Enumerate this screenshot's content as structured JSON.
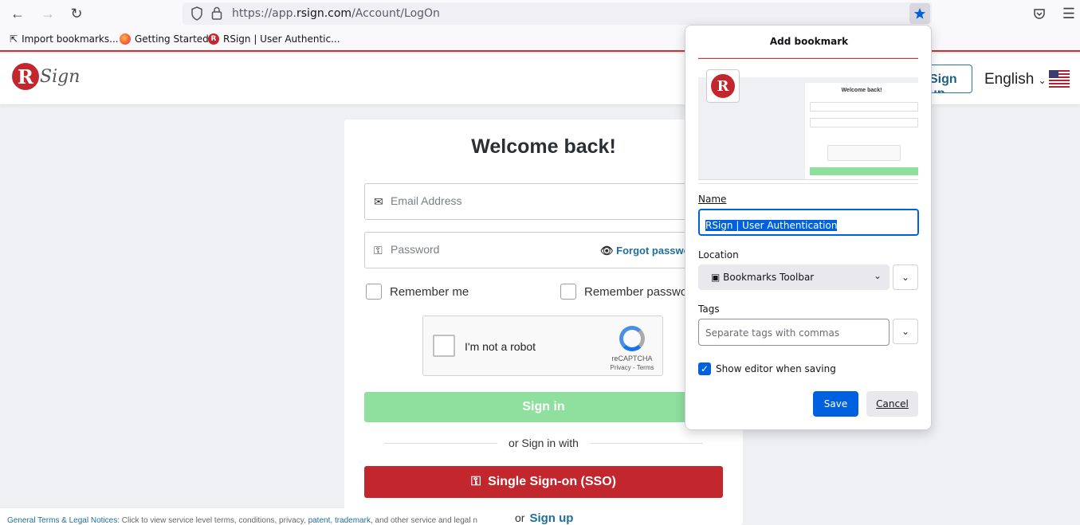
{
  "browser": {
    "url_prefix": "https://app.",
    "url_domain": "rsign.com",
    "url_path": "/Account/LogOn",
    "bookmarks": [
      {
        "label": "Import bookmarks..."
      },
      {
        "label": "Getting Started"
      },
      {
        "label": "RSign | User Authentic..."
      }
    ]
  },
  "header": {
    "logo_letter": "R",
    "logo_word": "Sign",
    "signup_label": "Sign up",
    "language": "English"
  },
  "login": {
    "title": "Welcome back!",
    "email_placeholder": "Email Address",
    "password_placeholder": "Password",
    "forgot_label": "Forgot password?",
    "remember_me": "Remember me",
    "remember_password": "Remember password",
    "captcha_label": "I'm not a robot",
    "captcha_brand": "reCAPTCHA",
    "captcha_links": "Privacy - Terms",
    "signin_label": "Sign in",
    "or_signin_with": "or Sign in with",
    "sso_label": "Single Sign-on (SSO)",
    "or_label": "or",
    "signup_label": "Sign up"
  },
  "footer": {
    "terms_link": "General Terms & Legal Notices",
    "text_1": ": Click to view service level terms, conditions, privacy, ",
    "patent": "patent",
    "sep": ", ",
    "trademark": "trademark",
    "text_2": ", and other service and legal n"
  },
  "bookmark_popup": {
    "title": "Add bookmark",
    "thumb_title": "Welcome back!",
    "name_label": "Name",
    "name_value": "RSign | User Authentication",
    "location_label": "Location",
    "location_value": "Bookmarks Toolbar",
    "tags_label": "Tags",
    "tags_placeholder": "Separate tags with commas",
    "show_editor_label": "Show editor when saving",
    "show_editor_checked": true,
    "save_label": "Save",
    "cancel_label": "Cancel",
    "accent_color": "#0061e0"
  }
}
